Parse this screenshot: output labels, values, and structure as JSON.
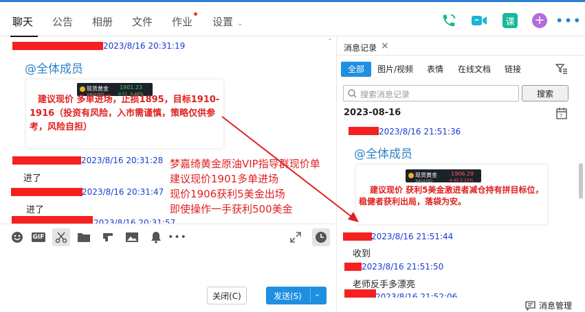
{
  "header": {
    "tabs": [
      {
        "label": "聊天",
        "active": true
      },
      {
        "label": "公告"
      },
      {
        "label": "相册"
      },
      {
        "label": "文件"
      },
      {
        "label": "作业",
        "badge_dot": true
      },
      {
        "label": "设置"
      }
    ],
    "icons": [
      "phone-call-icon",
      "video-call-icon",
      "lesson-icon",
      "add-app-icon",
      "more-icon"
    ],
    "lesson_icon_text": "课",
    "accent": "#2b7fd6"
  },
  "chat": {
    "messages": [
      {
        "timestamp": "2023/8/16 20:31:19",
        "text": "@全体成员"
      },
      {
        "timestamp": "2023/8/16 20:31:28",
        "text": "进了"
      },
      {
        "timestamp": "2023/8/16 20:31:47",
        "text": "进了"
      },
      {
        "timestamp": "2023/8/16 20:31:57"
      }
    ],
    "card1": {
      "text": "建议现价 多单进场，止损1895，目标1910-1916（投资有风险，入市需谨慎，策略仅供参考，风险自担）",
      "ticker": {
        "name": "现货黄金",
        "sub": "XAUUSD",
        "price": "1901.23",
        "change": "-9.51  -0.49%",
        "color": "#e8b32a"
      }
    },
    "annotation": [
      "梦嘉绮黄金原油VIP指导群现价单",
      "建议现价1901多单进场",
      "现价1906获利5美金出场",
      "即使操作一手获利500美金"
    ]
  },
  "input": {
    "toolbar_icons": [
      "emoji-icon",
      "gif-icon",
      "scissors-icon",
      "folder-icon",
      "music-icon",
      "image-icon",
      "bell-icon",
      "more-dots-icon"
    ],
    "gif_text": "GIF",
    "close_label": "关闭(C)",
    "send_label": "发送(S)"
  },
  "history": {
    "title": "消息记录",
    "filters": [
      "全部",
      "图片/视频",
      "表情",
      "在线文档",
      "链接"
    ],
    "active_filter": "全部",
    "search_placeholder": "搜索消息记录",
    "search_button": "搜索",
    "date": "2023-08-16",
    "messages": [
      {
        "timestamp": "2023/8/16 21:51:36",
        "text": "@全体成员"
      },
      {
        "timestamp": "2023/8/16 21:51:44",
        "text": "收到"
      },
      {
        "timestamp": "2023/8/16 21:51:50",
        "text": "老师反手多漂亮"
      },
      {
        "timestamp": "2023/8/16 21:52:06"
      }
    ],
    "card2": {
      "text": "建议现价 获利5美金激进者减仓持有拼目标位，稳健者获利出局，落袋为安。",
      "ticker": {
        "name": "现货黄金",
        "sub": "XAUUSD",
        "price": "1906.29",
        "change": "4.45  0.23%"
      }
    },
    "manage_label": "消息管理"
  }
}
